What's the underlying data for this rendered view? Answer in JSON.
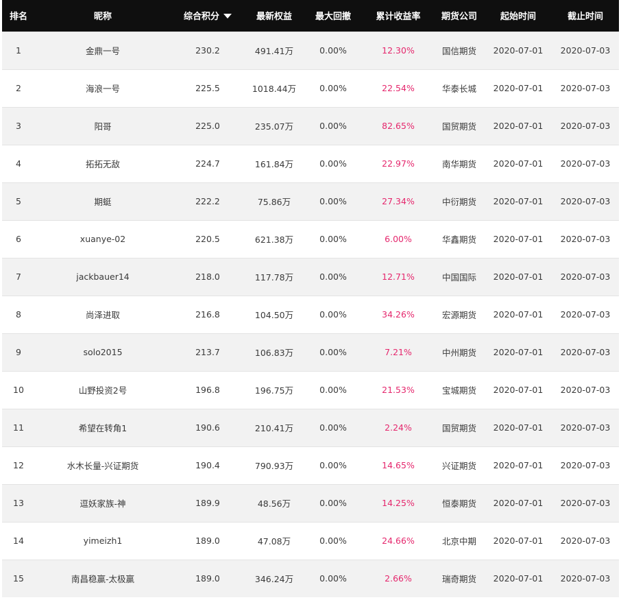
{
  "headers": {
    "rank": "排名",
    "nickname": "昵称",
    "score": "综合积分",
    "equity": "最新权益",
    "drawdown": "最大回撤",
    "return_rate": "累计收益率",
    "company": "期货公司",
    "start": "起始时间",
    "end": "截止时间"
  },
  "sort_icon": "triangle-down-icon",
  "colors": {
    "header_bg": "#0f0f0f",
    "header_text": "#ffffff",
    "row_odd": "#f2f2f2",
    "row_even": "#ffffff",
    "rate_text": "#e5276d"
  },
  "rows": [
    {
      "rank": "1",
      "nickname": "金鼎一号",
      "score": "230.2",
      "equity": "491.41万",
      "drawdown": "0.00%",
      "return_rate": "12.30%",
      "company": "国信期货",
      "start": "2020-07-01",
      "end": "2020-07-03"
    },
    {
      "rank": "2",
      "nickname": "海浪一号",
      "score": "225.5",
      "equity": "1018.44万",
      "drawdown": "0.00%",
      "return_rate": "22.54%",
      "company": "华泰长城",
      "start": "2020-07-01",
      "end": "2020-07-03"
    },
    {
      "rank": "3",
      "nickname": "阳哥",
      "score": "225.0",
      "equity": "235.07万",
      "drawdown": "0.00%",
      "return_rate": "82.65%",
      "company": "国贸期货",
      "start": "2020-07-01",
      "end": "2020-07-03"
    },
    {
      "rank": "4",
      "nickname": "拓拓无敌",
      "score": "224.7",
      "equity": "161.84万",
      "drawdown": "0.00%",
      "return_rate": "22.97%",
      "company": "南华期货",
      "start": "2020-07-01",
      "end": "2020-07-03"
    },
    {
      "rank": "5",
      "nickname": "期蜓",
      "score": "222.2",
      "equity": "75.86万",
      "drawdown": "0.00%",
      "return_rate": "27.34%",
      "company": "中衍期货",
      "start": "2020-07-01",
      "end": "2020-07-03"
    },
    {
      "rank": "6",
      "nickname": "xuanye-02",
      "score": "220.5",
      "equity": "621.38万",
      "drawdown": "0.00%",
      "return_rate": "6.00%",
      "company": "华鑫期货",
      "start": "2020-07-01",
      "end": "2020-07-03"
    },
    {
      "rank": "7",
      "nickname": "jackbauer14",
      "score": "218.0",
      "equity": "117.78万",
      "drawdown": "0.00%",
      "return_rate": "12.71%",
      "company": "中国国际",
      "start": "2020-07-01",
      "end": "2020-07-03"
    },
    {
      "rank": "8",
      "nickname": "尚泽进取",
      "score": "216.8",
      "equity": "104.50万",
      "drawdown": "0.00%",
      "return_rate": "34.26%",
      "company": "宏源期货",
      "start": "2020-07-01",
      "end": "2020-07-03"
    },
    {
      "rank": "9",
      "nickname": "solo2015",
      "score": "213.7",
      "equity": "106.83万",
      "drawdown": "0.00%",
      "return_rate": "7.21%",
      "company": "中州期货",
      "start": "2020-07-01",
      "end": "2020-07-03"
    },
    {
      "rank": "10",
      "nickname": "山野投资2号",
      "score": "196.8",
      "equity": "196.75万",
      "drawdown": "0.00%",
      "return_rate": "21.53%",
      "company": "宝城期货",
      "start": "2020-07-01",
      "end": "2020-07-03"
    },
    {
      "rank": "11",
      "nickname": "希望在转角1",
      "score": "190.6",
      "equity": "210.41万",
      "drawdown": "0.00%",
      "return_rate": "2.24%",
      "company": "国贸期货",
      "start": "2020-07-01",
      "end": "2020-07-03"
    },
    {
      "rank": "12",
      "nickname": "水木长量-兴证期货",
      "score": "190.4",
      "equity": "790.93万",
      "drawdown": "0.00%",
      "return_rate": "14.65%",
      "company": "兴证期货",
      "start": "2020-07-01",
      "end": "2020-07-03"
    },
    {
      "rank": "13",
      "nickname": "逗妖家族-神",
      "score": "189.9",
      "equity": "48.56万",
      "drawdown": "0.00%",
      "return_rate": "14.25%",
      "company": "恒泰期货",
      "start": "2020-07-01",
      "end": "2020-07-03"
    },
    {
      "rank": "14",
      "nickname": "yimeizh1",
      "score": "189.0",
      "equity": "47.08万",
      "drawdown": "0.00%",
      "return_rate": "24.66%",
      "company": "北京中期",
      "start": "2020-07-01",
      "end": "2020-07-03"
    },
    {
      "rank": "15",
      "nickname": "南昌稳赢-太极赢",
      "score": "189.0",
      "equity": "346.24万",
      "drawdown": "0.00%",
      "return_rate": "2.66%",
      "company": "瑞奇期货",
      "start": "2020-07-01",
      "end": "2020-07-03"
    }
  ]
}
